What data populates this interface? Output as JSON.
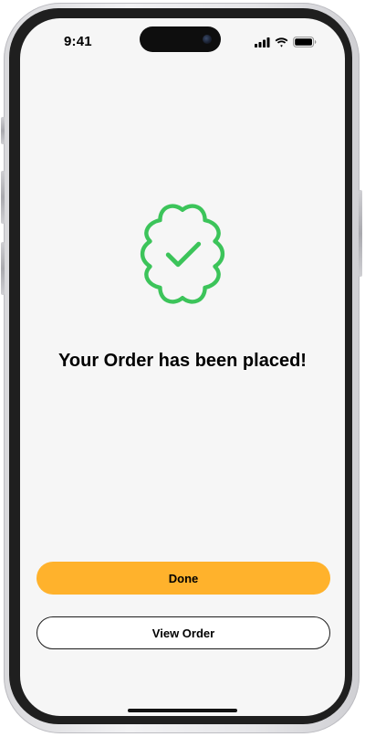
{
  "status_bar": {
    "time": "9:41",
    "icons": [
      "signal-icon",
      "wifi-icon",
      "battery-icon"
    ]
  },
  "confirmation": {
    "icon": "check-badge-icon",
    "title": "Your Order has been placed!"
  },
  "actions": {
    "done_label": "Done",
    "view_order_label": "View Order"
  },
  "colors": {
    "accent": "#ffb22c",
    "success": "#3cc45a",
    "background": "#f6f6f6"
  }
}
